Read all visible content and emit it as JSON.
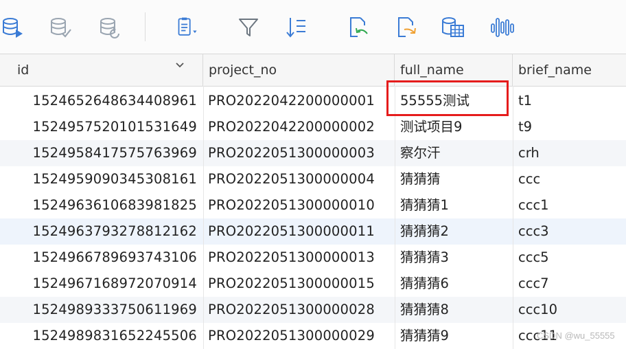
{
  "toolbar": {
    "buttons": [
      {
        "name": "db-run-icon",
        "color": "#3a7bd5"
      },
      {
        "name": "db-commit-icon",
        "color": "#9aa5b1"
      },
      {
        "name": "db-rollback-icon",
        "color": "#9aa5b1"
      },
      {
        "name": "document-menu-icon",
        "color": "#3a7bd5"
      },
      {
        "name": "filter-icon",
        "color": "#6c7680"
      },
      {
        "name": "sort-icon",
        "color": "#3a7bd5"
      },
      {
        "name": "import-icon",
        "color": "#3a7bd5"
      },
      {
        "name": "export-icon",
        "color": "#f0a030"
      },
      {
        "name": "table-data-icon",
        "color": "#3a7bd5"
      },
      {
        "name": "waveform-icon",
        "color": "#3a7bd5"
      }
    ]
  },
  "table": {
    "columns": [
      "id",
      "project_no",
      "full_name",
      "brief_name"
    ],
    "rows": [
      {
        "id": "1524652648634408961",
        "project_no": "PRO2022042200000001",
        "full_name": "55555测试",
        "brief_name": "t1"
      },
      {
        "id": "1524957520101531649",
        "project_no": "PRO2022042200000002",
        "full_name": "测试项目9",
        "brief_name": "t9"
      },
      {
        "id": "1524958417575763969",
        "project_no": "PRO2022051300000003",
        "full_name": "察尔汗",
        "brief_name": "crh"
      },
      {
        "id": "1524959090345308161",
        "project_no": "PRO2022051300000004",
        "full_name": "猜猜猜",
        "brief_name": "ccc"
      },
      {
        "id": "1524963610683981825",
        "project_no": "PRO2022051300000010",
        "full_name": "猜猜猜1",
        "brief_name": "ccc1"
      },
      {
        "id": "1524963793278812162",
        "project_no": "PRO2022051300000011",
        "full_name": "猜猜猜2",
        "brief_name": "ccc3"
      },
      {
        "id": "1524966789693743106",
        "project_no": "PRO2022051300000013",
        "full_name": "猜猜猜3",
        "brief_name": "ccc5"
      },
      {
        "id": "1524967168972070914",
        "project_no": "PRO2022051300000015",
        "full_name": "猜猜猜6",
        "brief_name": "ccc7"
      },
      {
        "id": "1524989333750611969",
        "project_no": "PRO2022051300000028",
        "full_name": "猜猜猜8",
        "brief_name": "ccc10"
      },
      {
        "id": "1524989831652245506",
        "project_no": "PRO2022051300000029",
        "full_name": "猜猜猜9",
        "brief_name": "ccc11"
      }
    ]
  },
  "highlight_color": "#e51c1c",
  "watermark": "CSDN @wu_55555"
}
